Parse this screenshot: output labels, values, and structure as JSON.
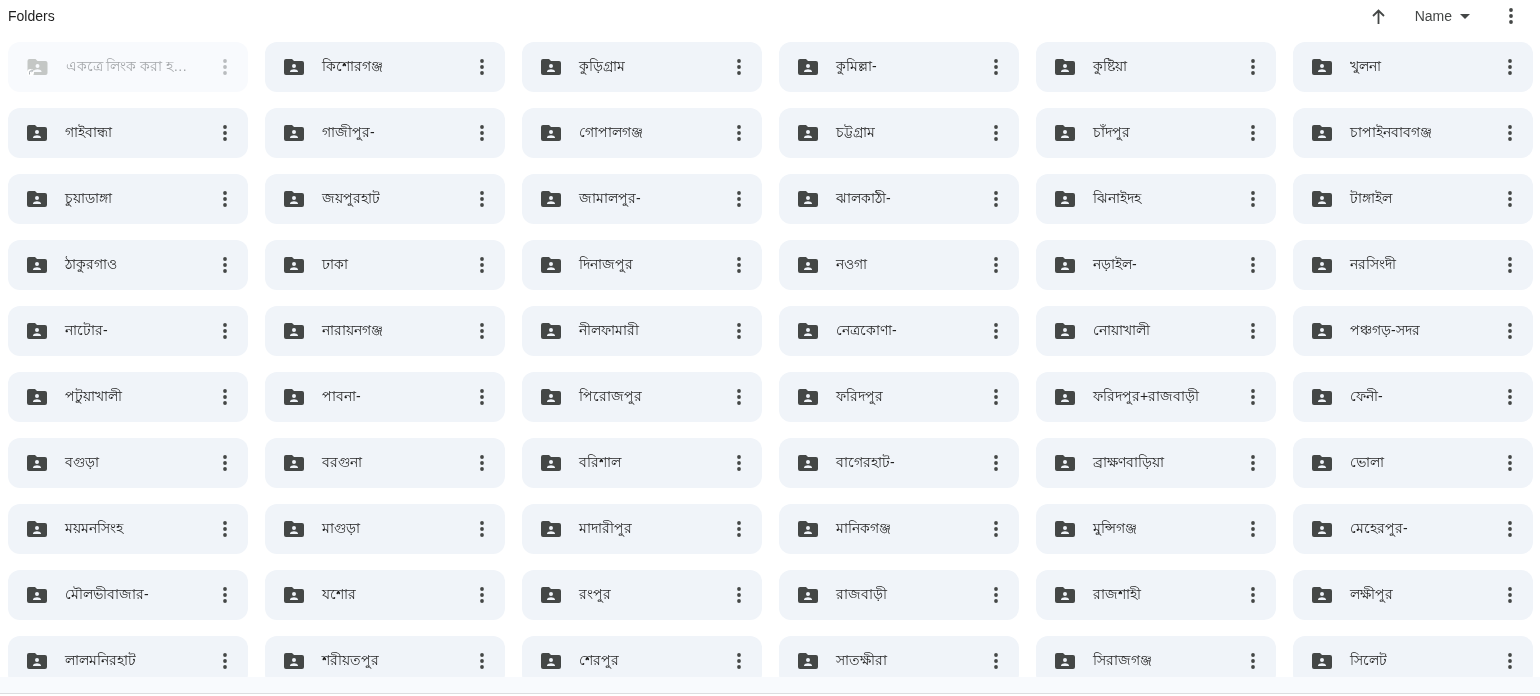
{
  "header": {
    "title": "Folders",
    "sort": {
      "label": "Name"
    }
  },
  "folders": [
    {
      "name": "একত্রে লিংক করা হ…",
      "kind": "shortcut",
      "disabled": true
    },
    {
      "name": "কিশোরগঞ্জ",
      "kind": "shared",
      "disabled": false
    },
    {
      "name": "কুড়িগ্রাম",
      "kind": "shared",
      "disabled": false
    },
    {
      "name": "কুমিল্লা-",
      "kind": "shared",
      "disabled": false
    },
    {
      "name": "কুষ্টিয়া",
      "kind": "shared",
      "disabled": false
    },
    {
      "name": "খুলনা",
      "kind": "shared",
      "disabled": false
    },
    {
      "name": "গাইবান্ধা",
      "kind": "shared",
      "disabled": false
    },
    {
      "name": "গাজীপুর-",
      "kind": "shared",
      "disabled": false
    },
    {
      "name": "গোপালগঞ্জ",
      "kind": "shared",
      "disabled": false
    },
    {
      "name": "চট্টগ্রাম",
      "kind": "shared",
      "disabled": false
    },
    {
      "name": "চাঁদপুর",
      "kind": "shared",
      "disabled": false
    },
    {
      "name": "চাপাইনবাবগঞ্জ",
      "kind": "shared",
      "disabled": false
    },
    {
      "name": "চুয়াডাঙ্গা",
      "kind": "shared",
      "disabled": false
    },
    {
      "name": "জয়পুরহাট",
      "kind": "shared",
      "disabled": false
    },
    {
      "name": "জামালপুর-",
      "kind": "shared",
      "disabled": false
    },
    {
      "name": "ঝালকাঠী-",
      "kind": "shared",
      "disabled": false
    },
    {
      "name": "ঝিনাইদহ",
      "kind": "shared",
      "disabled": false
    },
    {
      "name": "টাঙ্গাইল",
      "kind": "shared",
      "disabled": false
    },
    {
      "name": "ঠাকুরগাও",
      "kind": "shared",
      "disabled": false
    },
    {
      "name": "ঢাকা",
      "kind": "shared",
      "disabled": false
    },
    {
      "name": "দিনাজপুর",
      "kind": "shared",
      "disabled": false
    },
    {
      "name": "নওগা",
      "kind": "shared",
      "disabled": false
    },
    {
      "name": "নড়াইল-",
      "kind": "shared",
      "disabled": false
    },
    {
      "name": "নরসিংদী",
      "kind": "shared",
      "disabled": false
    },
    {
      "name": "নাটোর-",
      "kind": "shared",
      "disabled": false
    },
    {
      "name": "নারায়নগঞ্জ",
      "kind": "shared",
      "disabled": false
    },
    {
      "name": "নীলফামারী",
      "kind": "shared",
      "disabled": false
    },
    {
      "name": "নেত্রকোণা-",
      "kind": "shared",
      "disabled": false
    },
    {
      "name": "নোয়াখালী",
      "kind": "shared",
      "disabled": false
    },
    {
      "name": "পঞ্চগড়-সদর",
      "kind": "shared",
      "disabled": false
    },
    {
      "name": "পটুয়াখালী",
      "kind": "shared",
      "disabled": false
    },
    {
      "name": "পাবনা-",
      "kind": "shared",
      "disabled": false
    },
    {
      "name": "পিরোজপুর",
      "kind": "shared",
      "disabled": false
    },
    {
      "name": "ফরিদপুর",
      "kind": "shared",
      "disabled": false
    },
    {
      "name": "ফরিদপুর+রাজবাড়ী",
      "kind": "shared",
      "disabled": false
    },
    {
      "name": "ফেনী-",
      "kind": "shared",
      "disabled": false
    },
    {
      "name": "বগুড়া",
      "kind": "shared",
      "disabled": false
    },
    {
      "name": "বরগুনা",
      "kind": "shared",
      "disabled": false
    },
    {
      "name": "বরিশাল",
      "kind": "shared",
      "disabled": false
    },
    {
      "name": "বাগেরহাট-",
      "kind": "shared",
      "disabled": false
    },
    {
      "name": "ব্রাক্ষণবাড়িয়া",
      "kind": "shared",
      "disabled": false
    },
    {
      "name": "ভোলা",
      "kind": "shared",
      "disabled": false
    },
    {
      "name": "ময়মনসিংহ",
      "kind": "shared",
      "disabled": false
    },
    {
      "name": "মাগুড়া",
      "kind": "shared",
      "disabled": false
    },
    {
      "name": "মাদারীপুর",
      "kind": "shared",
      "disabled": false
    },
    {
      "name": "মানিকগঞ্জ",
      "kind": "shared",
      "disabled": false
    },
    {
      "name": "মুন্সিগঞ্জ",
      "kind": "shared",
      "disabled": false
    },
    {
      "name": "মেহেরপুর-",
      "kind": "shared",
      "disabled": false
    },
    {
      "name": "মৌলভীবাজার-",
      "kind": "shared",
      "disabled": false
    },
    {
      "name": "যশোর",
      "kind": "shared",
      "disabled": false
    },
    {
      "name": "রংপুর",
      "kind": "shared",
      "disabled": false
    },
    {
      "name": "রাজবাড়ী",
      "kind": "shared",
      "disabled": false
    },
    {
      "name": "রাজশাহী",
      "kind": "shared",
      "disabled": false
    },
    {
      "name": "লক্ষীপুর",
      "kind": "shared",
      "disabled": false
    },
    {
      "name": "লালমনিরহাট",
      "kind": "shared",
      "disabled": false
    },
    {
      "name": "শরীয়তপুর",
      "kind": "shared",
      "disabled": false
    },
    {
      "name": "শেরপুর",
      "kind": "shared",
      "disabled": false
    },
    {
      "name": "সাতক্ষীরা",
      "kind": "shared",
      "disabled": false
    },
    {
      "name": "সিরাজগঞ্জ",
      "kind": "shared",
      "disabled": false
    },
    {
      "name": "সিলেট",
      "kind": "shared",
      "disabled": false
    }
  ]
}
